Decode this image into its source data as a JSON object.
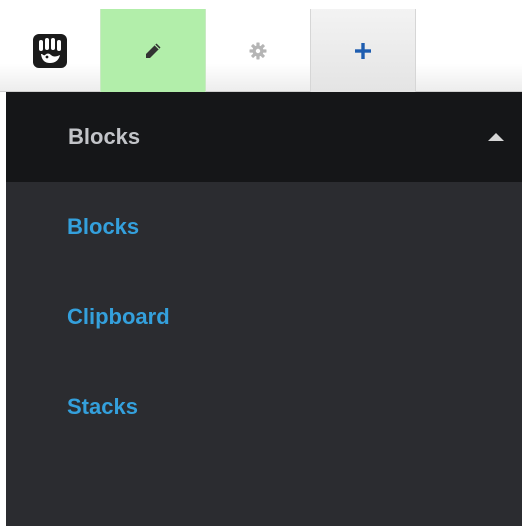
{
  "toolbar": {
    "logo_icon": "hand-logo-icon",
    "edit_icon": "pencil-icon",
    "settings_icon": "gear-icon",
    "add_icon": "plus-icon",
    "edit_active_color": "#b2eeaa",
    "accent_color": "#1e5db0"
  },
  "panel": {
    "title": "Blocks",
    "items": [
      {
        "label": "Blocks"
      },
      {
        "label": "Clipboard"
      },
      {
        "label": "Stacks"
      }
    ],
    "link_color": "#34a0dc"
  }
}
